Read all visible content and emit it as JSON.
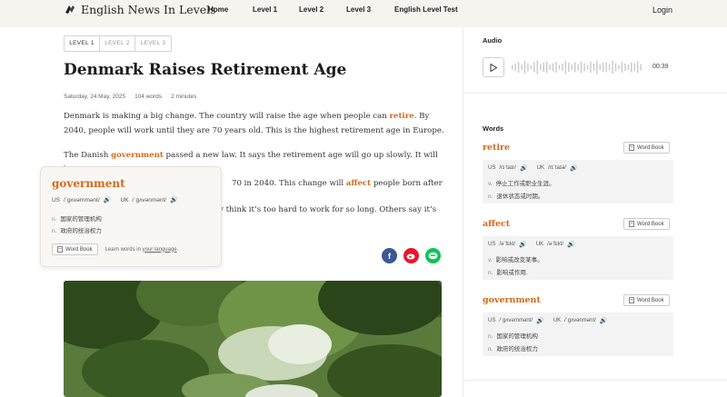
{
  "nav": {
    "logo_text": "English News In Levels",
    "items": [
      "Home",
      "Level 1",
      "Level 2",
      "Level 3",
      "English Level Test"
    ],
    "login": "Login"
  },
  "article": {
    "levels": [
      "LEVEL 1",
      "LEVEL 2",
      "LEVEL 3"
    ],
    "active_level": "LEVEL 1",
    "title": "Denmark Raises Retirement Age",
    "date": "Saturday, 24 May, 2025",
    "words": "104 words",
    "minutes": "2 minutes",
    "p1": {
      "t1": "Denmark is making a big change. The country will raise the age when people can ",
      "w1": "retire",
      "t2": ". By 2040, people will work until they are 70 years old. This is the highest retirement age in Europe."
    },
    "p2": {
      "t1": "The Danish ",
      "w1": "government",
      "t2": " passed a new law. It says the retirement age will go up slowly. It will be 68 in",
      "t3": "70 in 2040. This change will ",
      "w2": "affect",
      "t4": " people born after"
    },
    "p3": {
      "t1": "y think it’s too hard to work for so long. Others say it’s"
    }
  },
  "popup": {
    "word": "government",
    "us_label": "US",
    "us_phon": "/ˈɡʌvərnmənt/",
    "uk_label": "UK",
    "uk_phon": "/ˈɡʌvənmənt/",
    "defs": [
      {
        "pos": "n.",
        "text": "国家的管理机构"
      },
      {
        "pos": "n.",
        "text": "政府的统治权力"
      }
    ],
    "word_book": "Word Book",
    "learn_prefix": "Learn words in ",
    "learn_link": "your language",
    "learn_suffix": "."
  },
  "sidebar": {
    "audio_heading": "Audio",
    "audio_time": "00:39",
    "words_heading": "Words",
    "word_book": "Word Book",
    "words": [
      {
        "word": "retire",
        "us_label": "US",
        "us_phon": "/rɪˈtaɪr/",
        "uk_label": "UK",
        "uk_phon": "/rɪˈtaɪə/",
        "defs": [
          {
            "pos": "v.",
            "text": "停止工作或职业生涯。"
          },
          {
            "pos": "n.",
            "text": "退休状态或时期。"
          }
        ]
      },
      {
        "word": "affect",
        "us_label": "US",
        "us_phon": "/əˈfɛkt/",
        "uk_label": "UK",
        "uk_phon": "/əˈfɛkt/",
        "defs": [
          {
            "pos": "v.",
            "text": "影响或改变某事。"
          },
          {
            "pos": "n.",
            "text": "影响或作用."
          }
        ]
      },
      {
        "word": "government",
        "us_label": "US",
        "us_phon": "/ˈɡʌvərnmənt/",
        "uk_label": "UK",
        "uk_phon": "/ˈɡʌvənmənt/",
        "defs": [
          {
            "pos": "n.",
            "text": "国家的管理机构"
          },
          {
            "pos": "n.",
            "text": "政府的统治权力"
          }
        ]
      }
    ]
  },
  "colors": {
    "accent": "#d4691e",
    "topbar_bg": "#f6f4ef",
    "facebook": "#3b5998",
    "weibo": "#e6162d",
    "line": "#06c755"
  },
  "share_icons": [
    "facebook-icon",
    "weibo-icon",
    "line-icon"
  ]
}
